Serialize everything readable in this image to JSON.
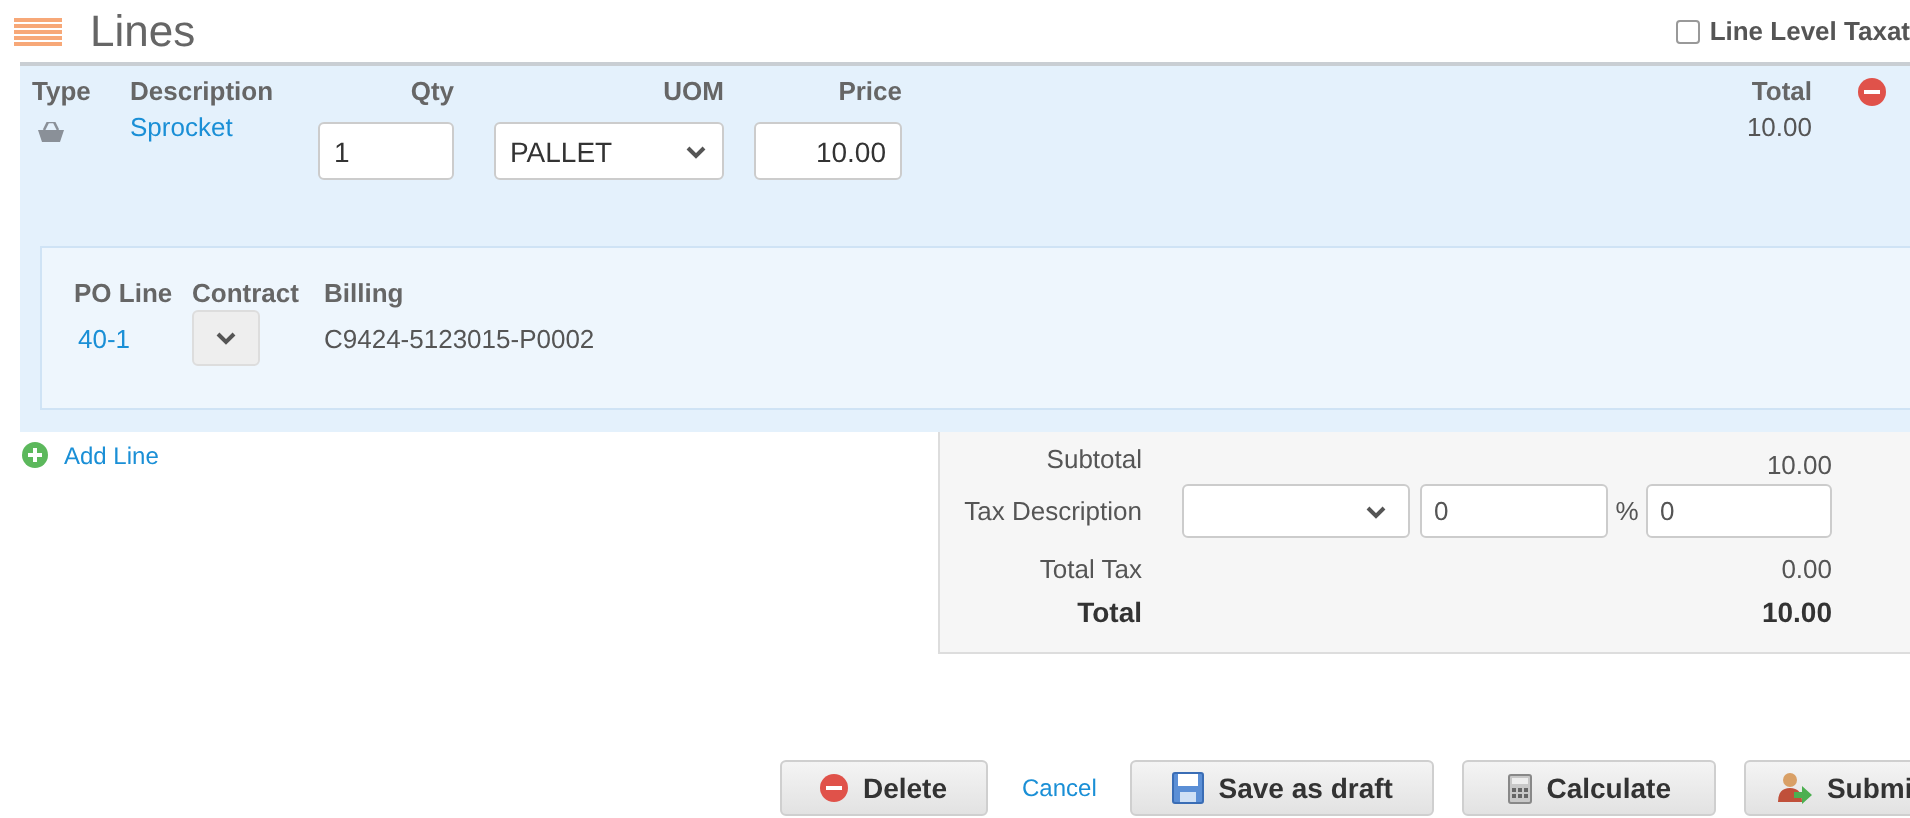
{
  "header": {
    "title": "Lines",
    "line_level_taxation": {
      "label": "Line Level Taxat",
      "checked": false
    }
  },
  "line": {
    "columns": [
      "Type",
      "Description",
      "Qty",
      "UOM",
      "Price",
      "Total"
    ],
    "item": {
      "description": "Sprocket",
      "qty": "1",
      "uom": "PALLET",
      "price": "10.00",
      "total": "10.00"
    },
    "details": {
      "columns": [
        "PO Line",
        "Contract",
        "Billing"
      ],
      "po_line": "40-1",
      "billing": "C9424-5123015-P0002"
    }
  },
  "add_line": "Add Line",
  "totals": {
    "subtotal_label": "Subtotal",
    "subtotal": "10.00",
    "tax_description_label": "Tax Description",
    "tax_amount": "0",
    "percent_sign": "%",
    "tax_percent": "0",
    "total_tax_label": "Total Tax",
    "total_tax": "0.00",
    "total_label": "Total",
    "total": "10.00"
  },
  "actions": [
    {
      "label": "Delete",
      "kind": "button"
    },
    {
      "label": "Cancel",
      "kind": "link"
    },
    {
      "label": "Save as draft",
      "kind": "button"
    },
    {
      "label": "Calculate",
      "kind": "button"
    },
    {
      "label": "Submi",
      "kind": "button"
    }
  ]
}
